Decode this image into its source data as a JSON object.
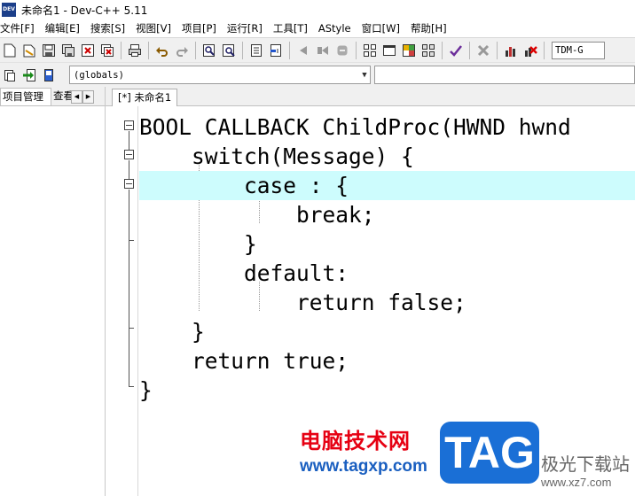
{
  "window": {
    "app_icon_text": "DEV",
    "title": "未命名1 - Dev-C++ 5.11"
  },
  "menu": [
    "文件[F]",
    "编辑[E]",
    "搜索[S]",
    "视图[V]",
    "项目[P]",
    "运行[R]",
    "工具[T]",
    "AStyle",
    "窗口[W]",
    "帮助[H]"
  ],
  "toolbar": {
    "compiler_label": "TDM-G",
    "scope_value": "(globals)"
  },
  "left_panel": {
    "tabs": [
      "项目管理",
      "查看"
    ]
  },
  "editor": {
    "file_tab": "[*] 未命名1",
    "code_lines": [
      "BOOL CALLBACK ChildProc(HWND hwnd",
      "    switch(Message) {",
      "        case : {",
      "            break;",
      "        }",
      "        default:",
      "            return false;",
      "    }",
      "    return true;",
      "}"
    ],
    "active_line_index": 2,
    "colors": {
      "active_line": "#cdfcfd"
    }
  },
  "watermark": {
    "cn_text": "电脑技术网",
    "url": "www.tagxp.com",
    "badge": "TAG",
    "site_cn": "极光下载站",
    "site_url": "www.xz7.com"
  }
}
